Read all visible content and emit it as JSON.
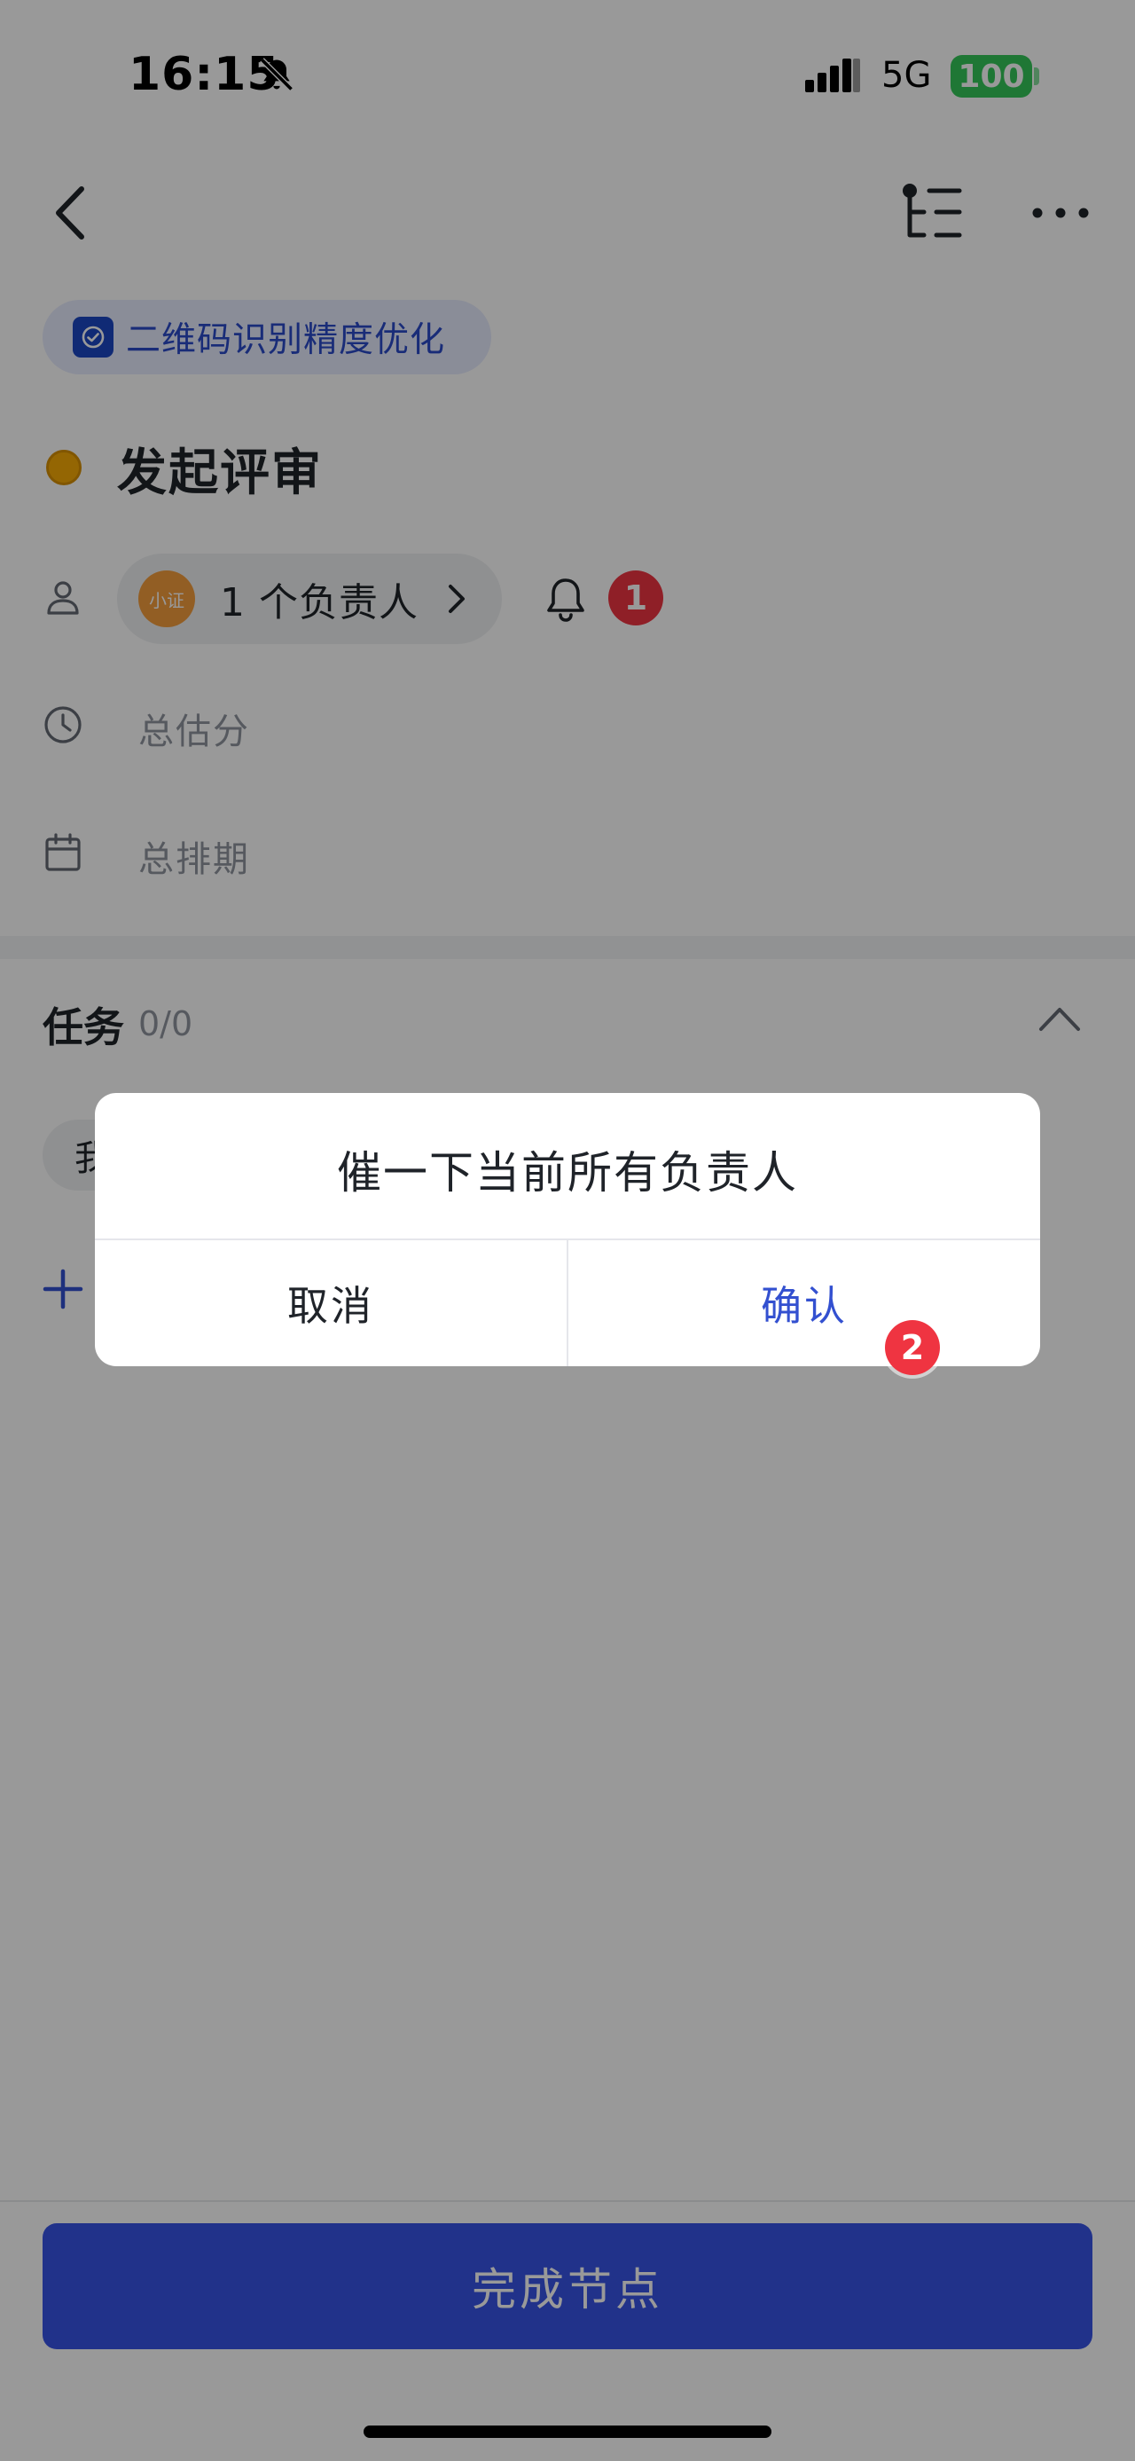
{
  "status_bar": {
    "time": "16:15",
    "network": "5G",
    "battery": "100",
    "icons": [
      "bell-slash-icon",
      "signal-icon"
    ]
  },
  "header": {
    "icons": [
      "chevron-left-icon",
      "tree-outline-icon",
      "more-horizontal-icon"
    ]
  },
  "project": {
    "name": "二维码识别精度优化",
    "icon": "checkbox-circle-icon"
  },
  "node": {
    "title": "发起评审",
    "status_color": "#f7aa06"
  },
  "fields": {
    "assignee_avatar": "小证",
    "assignee_text": "1 个负责人",
    "estimate_label": "总估分",
    "schedule_label": "总排期"
  },
  "markers": {
    "one": "1",
    "two": "2"
  },
  "tasks": {
    "title": "任务",
    "count": "0/0",
    "chip_text": "我"
  },
  "dialog": {
    "message": "催一下当前所有负责人",
    "cancel": "取消",
    "confirm": "确认"
  },
  "bottom": {
    "complete_button": "完成节点"
  },
  "colors": {
    "primary": "#3854e7",
    "marker": "#ef3441",
    "battery": "#34c759"
  }
}
